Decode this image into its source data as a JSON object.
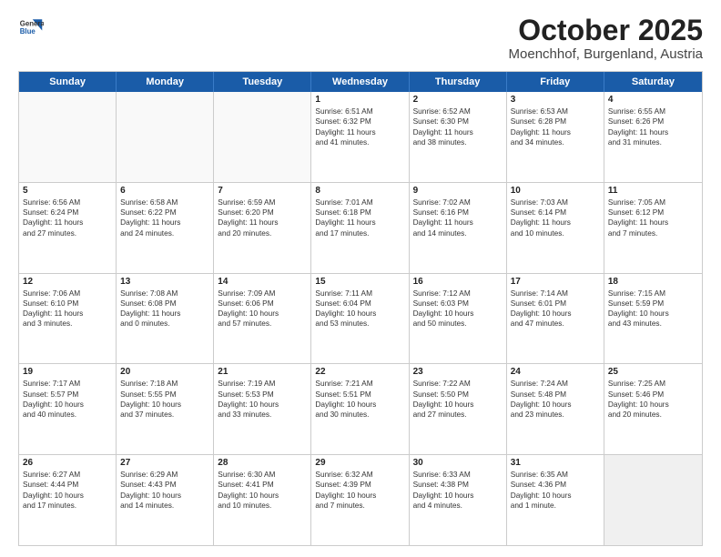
{
  "header": {
    "logo": {
      "line1": "General",
      "line2": "Blue"
    },
    "title": "October 2025",
    "subtitle": "Moenchhof, Burgenland, Austria"
  },
  "days_of_week": [
    "Sunday",
    "Monday",
    "Tuesday",
    "Wednesday",
    "Thursday",
    "Friday",
    "Saturday"
  ],
  "weeks": [
    [
      {
        "day": "",
        "lines": [],
        "empty": true
      },
      {
        "day": "",
        "lines": [],
        "empty": true
      },
      {
        "day": "",
        "lines": [],
        "empty": true
      },
      {
        "day": "1",
        "lines": [
          "Sunrise: 6:51 AM",
          "Sunset: 6:32 PM",
          "Daylight: 11 hours",
          "and 41 minutes."
        ]
      },
      {
        "day": "2",
        "lines": [
          "Sunrise: 6:52 AM",
          "Sunset: 6:30 PM",
          "Daylight: 11 hours",
          "and 38 minutes."
        ]
      },
      {
        "day": "3",
        "lines": [
          "Sunrise: 6:53 AM",
          "Sunset: 6:28 PM",
          "Daylight: 11 hours",
          "and 34 minutes."
        ]
      },
      {
        "day": "4",
        "lines": [
          "Sunrise: 6:55 AM",
          "Sunset: 6:26 PM",
          "Daylight: 11 hours",
          "and 31 minutes."
        ]
      }
    ],
    [
      {
        "day": "5",
        "lines": [
          "Sunrise: 6:56 AM",
          "Sunset: 6:24 PM",
          "Daylight: 11 hours",
          "and 27 minutes."
        ]
      },
      {
        "day": "6",
        "lines": [
          "Sunrise: 6:58 AM",
          "Sunset: 6:22 PM",
          "Daylight: 11 hours",
          "and 24 minutes."
        ]
      },
      {
        "day": "7",
        "lines": [
          "Sunrise: 6:59 AM",
          "Sunset: 6:20 PM",
          "Daylight: 11 hours",
          "and 20 minutes."
        ]
      },
      {
        "day": "8",
        "lines": [
          "Sunrise: 7:01 AM",
          "Sunset: 6:18 PM",
          "Daylight: 11 hours",
          "and 17 minutes."
        ]
      },
      {
        "day": "9",
        "lines": [
          "Sunrise: 7:02 AM",
          "Sunset: 6:16 PM",
          "Daylight: 11 hours",
          "and 14 minutes."
        ]
      },
      {
        "day": "10",
        "lines": [
          "Sunrise: 7:03 AM",
          "Sunset: 6:14 PM",
          "Daylight: 11 hours",
          "and 10 minutes."
        ]
      },
      {
        "day": "11",
        "lines": [
          "Sunrise: 7:05 AM",
          "Sunset: 6:12 PM",
          "Daylight: 11 hours",
          "and 7 minutes."
        ]
      }
    ],
    [
      {
        "day": "12",
        "lines": [
          "Sunrise: 7:06 AM",
          "Sunset: 6:10 PM",
          "Daylight: 11 hours",
          "and 3 minutes."
        ]
      },
      {
        "day": "13",
        "lines": [
          "Sunrise: 7:08 AM",
          "Sunset: 6:08 PM",
          "Daylight: 11 hours",
          "and 0 minutes."
        ]
      },
      {
        "day": "14",
        "lines": [
          "Sunrise: 7:09 AM",
          "Sunset: 6:06 PM",
          "Daylight: 10 hours",
          "and 57 minutes."
        ]
      },
      {
        "day": "15",
        "lines": [
          "Sunrise: 7:11 AM",
          "Sunset: 6:04 PM",
          "Daylight: 10 hours",
          "and 53 minutes."
        ]
      },
      {
        "day": "16",
        "lines": [
          "Sunrise: 7:12 AM",
          "Sunset: 6:03 PM",
          "Daylight: 10 hours",
          "and 50 minutes."
        ]
      },
      {
        "day": "17",
        "lines": [
          "Sunrise: 7:14 AM",
          "Sunset: 6:01 PM",
          "Daylight: 10 hours",
          "and 47 minutes."
        ]
      },
      {
        "day": "18",
        "lines": [
          "Sunrise: 7:15 AM",
          "Sunset: 5:59 PM",
          "Daylight: 10 hours",
          "and 43 minutes."
        ]
      }
    ],
    [
      {
        "day": "19",
        "lines": [
          "Sunrise: 7:17 AM",
          "Sunset: 5:57 PM",
          "Daylight: 10 hours",
          "and 40 minutes."
        ]
      },
      {
        "day": "20",
        "lines": [
          "Sunrise: 7:18 AM",
          "Sunset: 5:55 PM",
          "Daylight: 10 hours",
          "and 37 minutes."
        ]
      },
      {
        "day": "21",
        "lines": [
          "Sunrise: 7:19 AM",
          "Sunset: 5:53 PM",
          "Daylight: 10 hours",
          "and 33 minutes."
        ]
      },
      {
        "day": "22",
        "lines": [
          "Sunrise: 7:21 AM",
          "Sunset: 5:51 PM",
          "Daylight: 10 hours",
          "and 30 minutes."
        ]
      },
      {
        "day": "23",
        "lines": [
          "Sunrise: 7:22 AM",
          "Sunset: 5:50 PM",
          "Daylight: 10 hours",
          "and 27 minutes."
        ]
      },
      {
        "day": "24",
        "lines": [
          "Sunrise: 7:24 AM",
          "Sunset: 5:48 PM",
          "Daylight: 10 hours",
          "and 23 minutes."
        ]
      },
      {
        "day": "25",
        "lines": [
          "Sunrise: 7:25 AM",
          "Sunset: 5:46 PM",
          "Daylight: 10 hours",
          "and 20 minutes."
        ]
      }
    ],
    [
      {
        "day": "26",
        "lines": [
          "Sunrise: 6:27 AM",
          "Sunset: 4:44 PM",
          "Daylight: 10 hours",
          "and 17 minutes."
        ]
      },
      {
        "day": "27",
        "lines": [
          "Sunrise: 6:29 AM",
          "Sunset: 4:43 PM",
          "Daylight: 10 hours",
          "and 14 minutes."
        ]
      },
      {
        "day": "28",
        "lines": [
          "Sunrise: 6:30 AM",
          "Sunset: 4:41 PM",
          "Daylight: 10 hours",
          "and 10 minutes."
        ]
      },
      {
        "day": "29",
        "lines": [
          "Sunrise: 6:32 AM",
          "Sunset: 4:39 PM",
          "Daylight: 10 hours",
          "and 7 minutes."
        ]
      },
      {
        "day": "30",
        "lines": [
          "Sunrise: 6:33 AM",
          "Sunset: 4:38 PM",
          "Daylight: 10 hours",
          "and 4 minutes."
        ]
      },
      {
        "day": "31",
        "lines": [
          "Sunrise: 6:35 AM",
          "Sunset: 4:36 PM",
          "Daylight: 10 hours",
          "and 1 minute."
        ]
      },
      {
        "day": "",
        "lines": [],
        "empty": true,
        "shaded": true
      }
    ]
  ]
}
